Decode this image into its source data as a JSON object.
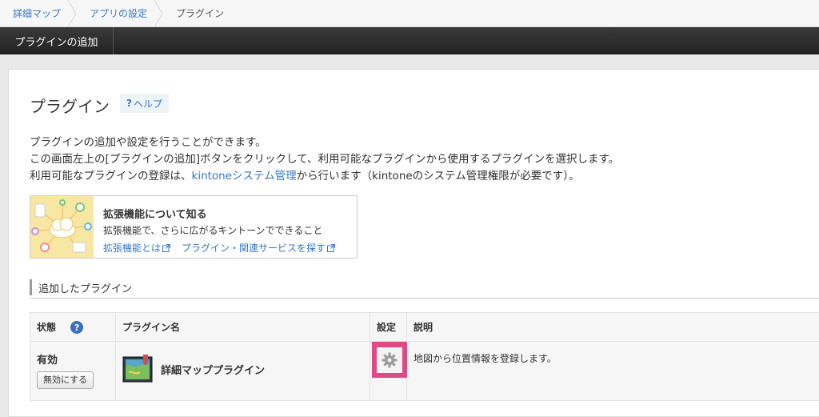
{
  "breadcrumb": [
    {
      "label": "詳細マップ"
    },
    {
      "label": "アプリの設定"
    },
    {
      "label": "プラグイン"
    }
  ],
  "actionbar": {
    "add_plugin_label": "プラグインの追加"
  },
  "page": {
    "title": "プラグイン",
    "help_q": "?",
    "help_label": "ヘルプ",
    "desc_line1": "プラグインの追加や設定を行うことができます。",
    "desc_line2": "この画面左上の[プラグインの追加]ボタンをクリックして、利用可能なプラグインから使用するプラグインを選択します。",
    "desc_line3_pre": "利用可能なプラグインの登録は、",
    "desc_line3_link": "kintoneシステム管理",
    "desc_line3_post": "から行います（kintoneのシステム管理権限が必要です）。"
  },
  "ext_card": {
    "title": "拡張機能について知る",
    "subtitle": "拡張機能で、さらに広がるキントーンでできること",
    "link1": "拡張機能とは",
    "link2": "プラグイン・関連サービスを探す"
  },
  "section": {
    "title": "追加したプラグイン"
  },
  "table": {
    "headers": {
      "status": "状態",
      "status_help": "?",
      "name": "プラグイン名",
      "settings": "設定",
      "description": "説明"
    },
    "rows": [
      {
        "status": "有効",
        "disable_label": "無効にする",
        "name": "詳細マッププラグイン",
        "description": "地図から位置情報を登録します。"
      }
    ]
  },
  "colors": {
    "link": "#3577c1",
    "highlight": "#e04a84",
    "actionbar": "#2b2b2b"
  }
}
